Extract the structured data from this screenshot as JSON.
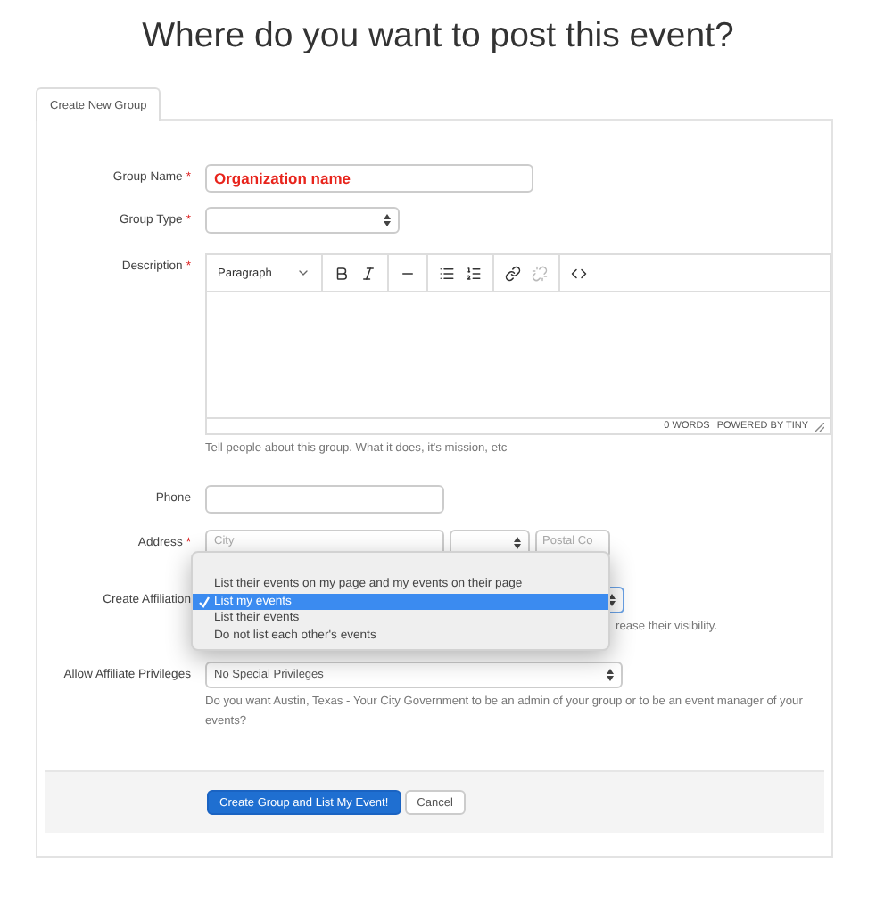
{
  "heading": "Where do you want to post this event?",
  "tabs": [
    {
      "label": "Create New Group",
      "selected": true
    }
  ],
  "required_mark": "*",
  "group_name": {
    "label": "Group Name",
    "required": true,
    "value": "Organization name"
  },
  "group_type": {
    "label": "Group Type",
    "required": true
  },
  "description": {
    "label": "Description",
    "required": true,
    "block_format": "Paragraph",
    "word_count": "0 WORDS",
    "branding": "POWERED BY TINY",
    "help": "Tell people about this group. What it does, it's mission, etc"
  },
  "phone": {
    "label": "Phone"
  },
  "address": {
    "label": "Address",
    "required": true,
    "city_placeholder": "City",
    "postal_placeholder": "Postal Co"
  },
  "affiliation": {
    "label": "Create Affiliation",
    "help": "rease their visibility.",
    "options": [
      {
        "kind": "option",
        "label": "List their events on my page and my events on their page",
        "selected": false
      },
      {
        "kind": "option",
        "label": "List my events",
        "selected": true
      },
      {
        "kind": "option",
        "label": "List their events",
        "selected": false
      },
      {
        "kind": "option",
        "label": "Do not list each other's events",
        "selected": false
      }
    ]
  },
  "privileges": {
    "label": "Allow Affiliate Privileges",
    "value": "No Special Privileges",
    "help": "Do you want Austin, Texas - Your City Government to be an admin of your group or to be an event manager of your events?"
  },
  "buttons": [
    {
      "label": "Create Group and List My Event!",
      "kind": "primary"
    },
    {
      "label": "Cancel",
      "kind": "default"
    }
  ]
}
